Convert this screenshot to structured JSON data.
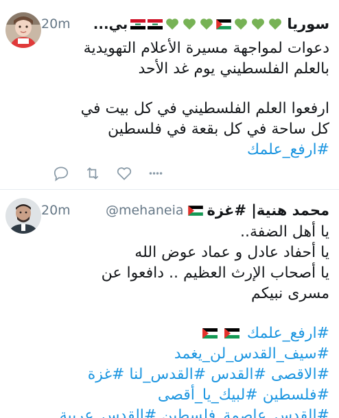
{
  "colors": {
    "accent": "#1b95e0",
    "secondary_text": "#657786",
    "heart_green": "#77b255",
    "divider": "#e6ecf0"
  },
  "tweets": [
    {
      "display_name": "سوريا",
      "name_tail": "بي...",
      "handle": "",
      "time": "20m",
      "header_icons": [
        "green-heart-icon",
        "green-heart-icon",
        "green-heart-icon",
        "palestine-flag-icon",
        "green-heart-icon",
        "green-heart-icon",
        "green-heart-icon",
        "iraq-flag-icon",
        "iraq-flag-icon"
      ],
      "lines": [
        "دعوات لمواجهة مسيرة الأعلام التهويدية",
        "بالعلم الفلسطيني يوم غد الأحد",
        "",
        "ارفعوا العلم الفلسطيني في كل بيت في",
        "كل ساحة في كل بقعة في فلسطين"
      ],
      "hashtags": [
        "#ارفع_علمك"
      ],
      "actions": [
        "reply-icon",
        "retweet-icon",
        "like-icon",
        "more-icon"
      ]
    },
    {
      "display_name": "محمد هنية| #غزة",
      "handle": "@mehaneia",
      "time": "20m",
      "header_icons": [
        "palestine-flag-icon"
      ],
      "lines": [
        "يا أهل الضفة..",
        "يا أحفاد عادل و عماد عوض الله",
        "يا أصحاب الإرث العظيم .. دافعوا عن",
        "مسرى نبيكم"
      ],
      "hashtag_lines": [
        "#ارفع_علمك",
        "#سيف_القدس_لن_يغمد",
        "#الاقصى #القدس #القدس_لنا #غزة",
        "#فلسطين #لبيك_يا_أقصى",
        "#القدس_عاصمة_فلسطين #القدس_عربية"
      ]
    }
  ]
}
